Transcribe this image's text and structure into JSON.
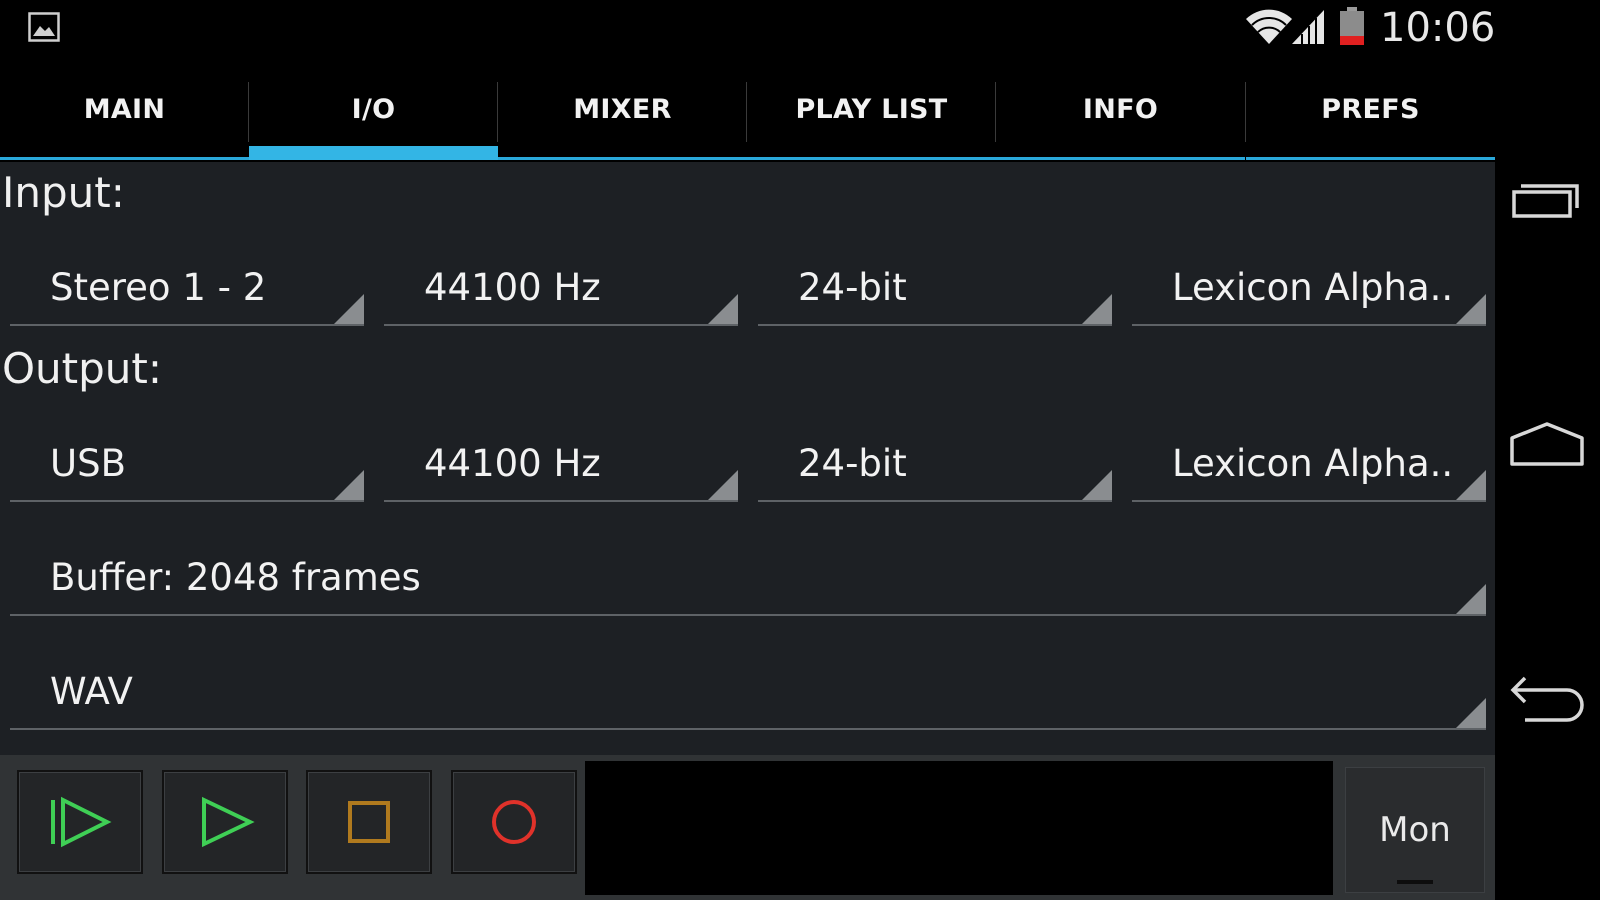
{
  "status_bar": {
    "time": "10:06",
    "icons": [
      "gallery-icon",
      "wifi-icon",
      "cell-signal-icon",
      "battery-icon"
    ]
  },
  "tabs": [
    {
      "label": "MAIN",
      "active": false
    },
    {
      "label": "I/O",
      "active": true
    },
    {
      "label": "MIXER",
      "active": false
    },
    {
      "label": "PLAY LIST",
      "active": false
    },
    {
      "label": "INFO",
      "active": false
    },
    {
      "label": "PREFS",
      "active": false
    }
  ],
  "input": {
    "label": "Input:",
    "channels": "Stereo 1 - 2",
    "sample_rate": "44100 Hz",
    "bit_depth": "24-bit",
    "device": "Lexicon Alpha.."
  },
  "output": {
    "label": "Output:",
    "channels": "USB",
    "sample_rate": "44100 Hz",
    "bit_depth": "24-bit",
    "device": "Lexicon Alpha.."
  },
  "buffer": "Buffer: 2048 frames",
  "format": "WAV",
  "transport": {
    "buttons": [
      "play-from-start-icon",
      "play-icon",
      "stop-icon",
      "record-icon"
    ],
    "mon_label": "Mon"
  },
  "colors": {
    "accent": "#33b5e5",
    "play": "#3fcf55",
    "stop": "#b07a1e",
    "record": "#e0322a",
    "battery_low": "#e02020"
  }
}
